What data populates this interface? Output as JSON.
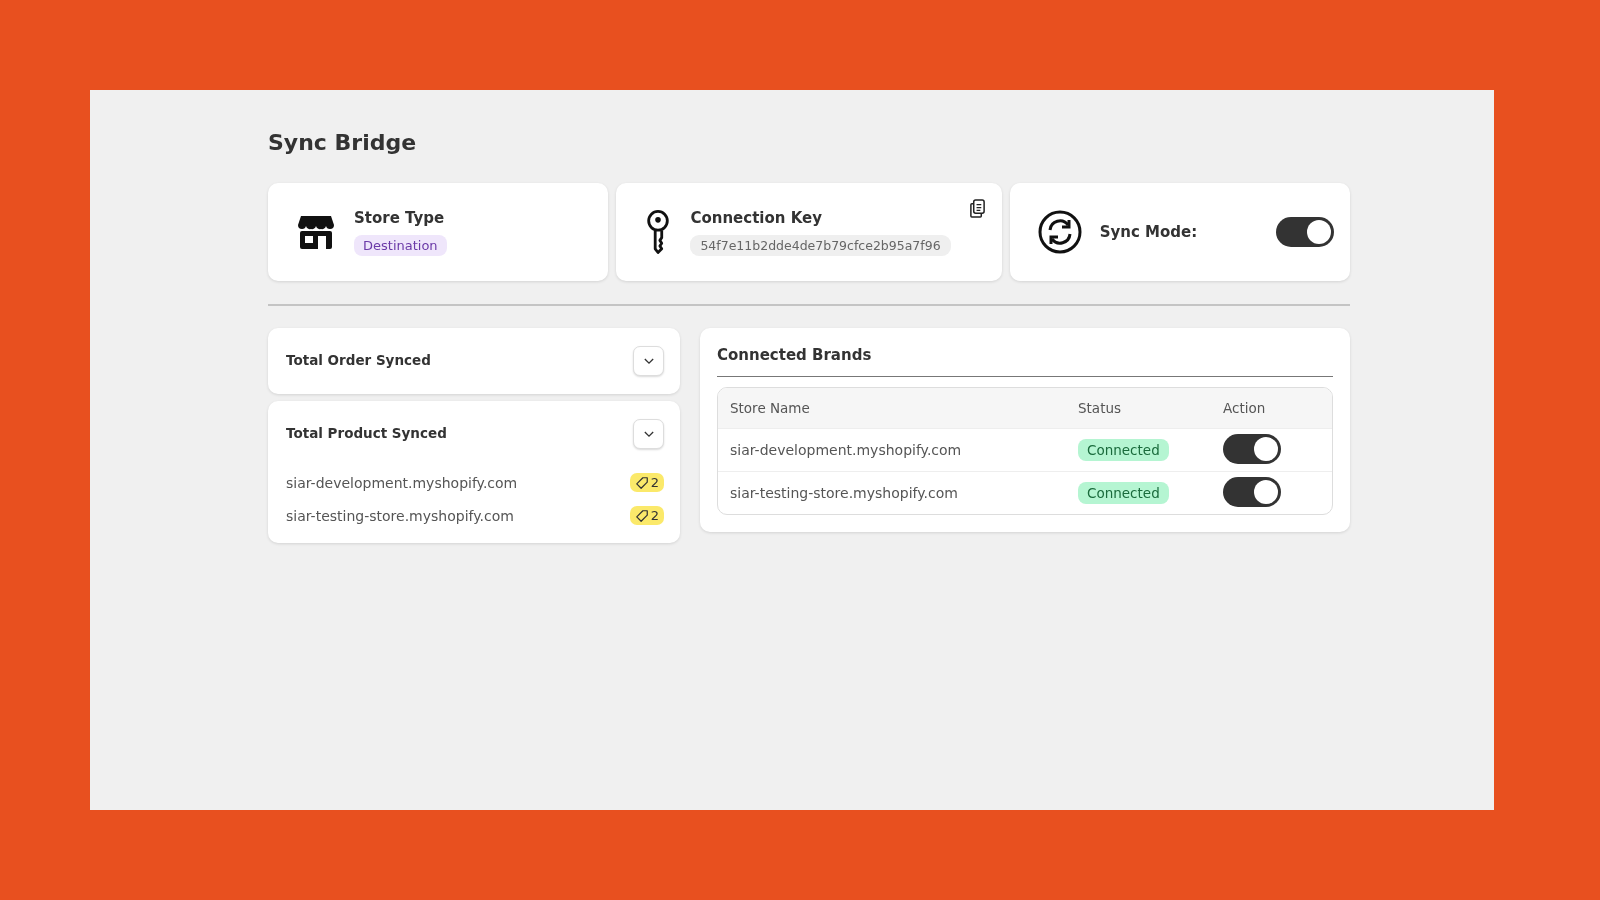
{
  "title": "Sync Bridge",
  "store_type": {
    "label": "Store Type",
    "badge": "Destination"
  },
  "connection_key": {
    "label": "Connection Key",
    "value": "54f7e11b2dde4de7b79cfce2b95a7f96"
  },
  "sync_mode": {
    "label": "Sync Mode:",
    "on": true
  },
  "stats": [
    {
      "title": "Total Order Synced",
      "expanded": false
    },
    {
      "title": "Total Product Synced",
      "expanded": false,
      "items": [
        {
          "store": "siar-development.myshopify.com",
          "count": "2"
        },
        {
          "store": "siar-testing-store.myshopify.com",
          "count": "2"
        }
      ]
    }
  ],
  "brands": {
    "title": "Connected Brands",
    "columns": [
      "Store Name",
      "Status",
      "Action"
    ],
    "rows": [
      {
        "store": "siar-development.myshopify.com",
        "status": "Connected",
        "on": true
      },
      {
        "store": "siar-testing-store.myshopify.com",
        "status": "Connected",
        "on": true
      }
    ]
  }
}
